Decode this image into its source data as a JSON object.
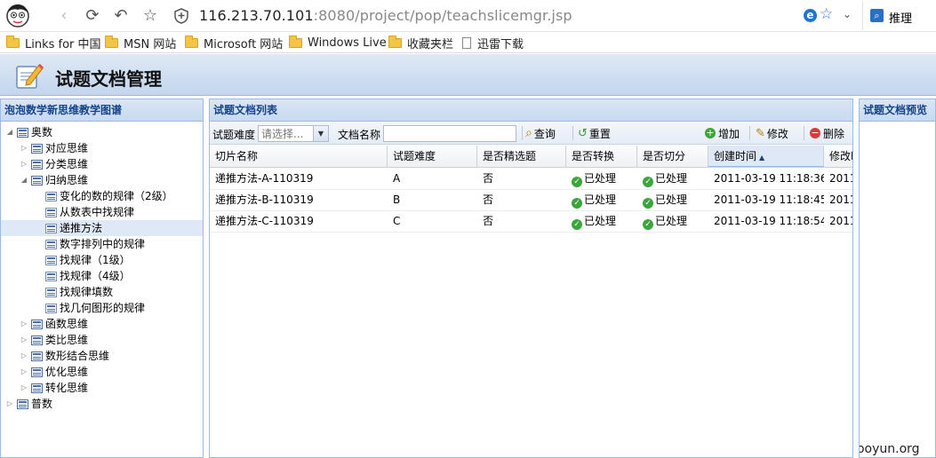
{
  "browser": {
    "address_host": "116.213.70.101",
    "address_rest": ":8080/project/pop/teachslicemgr.jsp",
    "search_label": "推理",
    "bookmarks": [
      "Links for 中国",
      "MSN 网站",
      "Microsoft 网站",
      "Windows Live",
      "收藏夹栏",
      "迅雷下载"
    ]
  },
  "app": {
    "title": "试题文档管理"
  },
  "tree_panel": {
    "title": "泡泡数学新思维教学图谱",
    "nodes": [
      "奥数",
      "对应思维",
      "分类思维",
      "归纳思维",
      "变化的数的规律（2级）",
      "从数表中找规律",
      "递推方法",
      "数字排列中的规律",
      "找规律（1级）",
      "找规律（4级）",
      "找规律填数",
      "找几何图形的规律",
      "函数思维",
      "类比思维",
      "数形结合思维",
      "优化思维",
      "转化思维",
      "普数"
    ],
    "selected": "递推方法"
  },
  "list_panel": {
    "title": "试题文档列表",
    "toolbar": {
      "difficulty_label": "试题难度",
      "difficulty_placeholder": "请选择...",
      "docname_label": "文档名称",
      "query": "查询",
      "reset": "重置",
      "add": "增加",
      "edit": "修改",
      "delete": "删除"
    },
    "columns": [
      "切片名称",
      "试题难度",
      "是否精选题",
      "是否转换",
      "是否切分",
      "创建时间",
      "修改时"
    ],
    "rows": [
      [
        "递推方法-A-110319",
        "A",
        "否",
        "已处理",
        "已处理",
        "2011-03-19 11:18:36",
        "2011"
      ],
      [
        "递推方法-B-110319",
        "B",
        "否",
        "已处理",
        "已处理",
        "2011-03-19 11:18:45",
        "2011"
      ],
      [
        "递推方法-C-110319",
        "C",
        "否",
        "已处理",
        "已处理",
        "2011-03-19 11:18:54",
        "2011"
      ]
    ]
  },
  "preview_panel": {
    "title": "试题文档预览"
  },
  "watermark": "www.wooyun.org"
}
